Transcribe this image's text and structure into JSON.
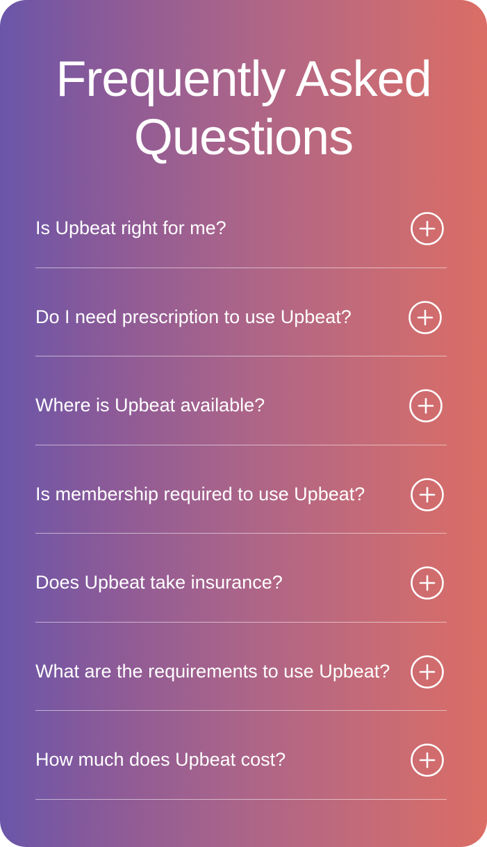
{
  "title_line1": "Frequently Asked",
  "title_line2": "Questions",
  "faq": [
    {
      "question": "Is Upbeat right for me?",
      "icon": "plus-circle-icon"
    },
    {
      "question": "Do I need prescription to use Upbeat?",
      "icon": "plus-circle-icon"
    },
    {
      "question": "Where is Upbeat available?",
      "icon": "plus-circle-icon"
    },
    {
      "question": "Is membership required to use Upbeat?",
      "icon": "plus-circle-icon"
    },
    {
      "question": "Does Upbeat take insurance?",
      "icon": "plus-circle-icon"
    },
    {
      "question": "What are the requirements to use Upbeat?",
      "icon": "plus-circle-icon"
    },
    {
      "question": "How much does Upbeat cost?",
      "icon": "plus-circle-icon"
    }
  ],
  "colors": {
    "gradient_start": "#6a56a9",
    "gradient_end": "#db6d65",
    "text": "#ffffff"
  }
}
